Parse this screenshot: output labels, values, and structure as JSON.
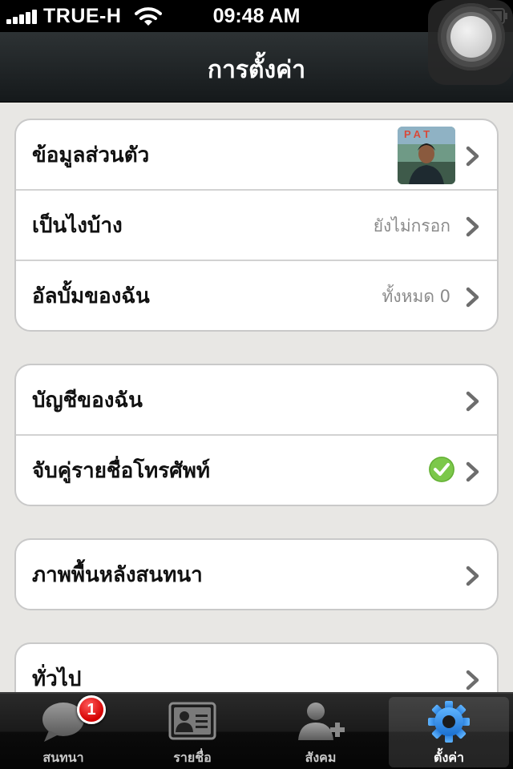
{
  "status_bar": {
    "carrier": "TRUE-H",
    "time": "09:48 AM",
    "icons": [
      "signal-icon",
      "wifi-icon",
      "alarm-icon",
      "battery-charging-icon"
    ]
  },
  "navbar": {
    "title": "การตั้งค่า"
  },
  "groups": [
    {
      "rows": [
        {
          "label": "ข้อมูลส่วนตัว",
          "value": "",
          "accessory": "avatar"
        },
        {
          "label": "เป็นไงบ้าง",
          "value": "ยังไม่กรอก"
        },
        {
          "label": "อัลบั้มของฉัน",
          "value": "ทั้งหมด 0"
        }
      ]
    },
    {
      "rows": [
        {
          "label": "บัญชีของฉัน",
          "value": ""
        },
        {
          "label": "จับคู่รายชื่อโทรศัพท์",
          "value": "",
          "accessory": "check-icon"
        }
      ]
    },
    {
      "rows": [
        {
          "label": "ภาพพื้นหลังสนทนา",
          "value": ""
        }
      ]
    },
    {
      "rows": [
        {
          "label": "ทั่วไป",
          "value": ""
        }
      ]
    }
  ],
  "tabbar": {
    "tabs": [
      {
        "label": "สนทนา",
        "icon": "chat-bubble-icon",
        "badge": "1"
      },
      {
        "label": "รายชื่อ",
        "icon": "contact-card-icon"
      },
      {
        "label": "สังคม",
        "icon": "add-friend-icon"
      },
      {
        "label": "ตั้งค่า",
        "icon": "gear-icon",
        "active": true
      }
    ]
  },
  "colors": {
    "accent_blue": "#2f8fe8",
    "check_green": "#7cc84a",
    "badge_red": "#d40000",
    "background": "#e8e7e4"
  }
}
